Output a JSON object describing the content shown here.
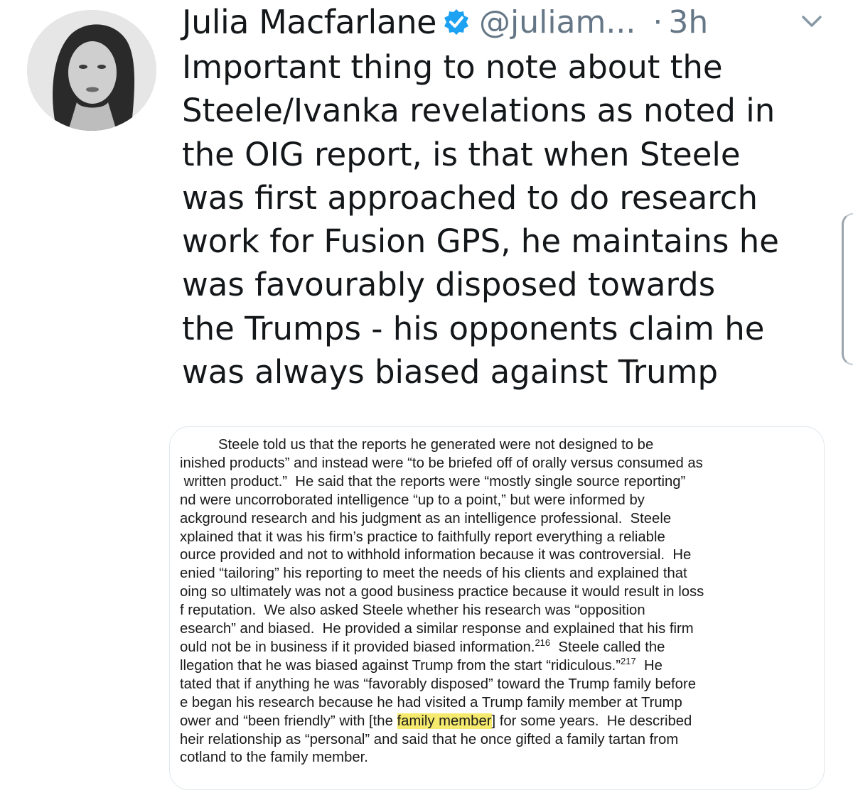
{
  "tweet": {
    "author": {
      "display_name": "Julia Macfarlane",
      "handle": "@juliam...",
      "verified": true,
      "avatar": "profile-photo-grayscale"
    },
    "separator": "·",
    "time": "3h",
    "menu_icon": "chevron-down-icon",
    "text_lines": [
      "Important thing to note about the",
      "Steele/Ivanka revelations as noted in",
      "the OIG report, is that when Steele",
      "was first approached to do research",
      "work for Fusion GPS, he maintains he",
      "was favourably disposed towards",
      "the Trumps - his opponents claim he",
      "was always biased against Trump"
    ]
  },
  "media": {
    "document_lines": [
      {
        "text": "Steele told us that the reports he generated were not designed to be"
      },
      {
        "text": "inished products” and instead were “to be briefed off of orally versus consumed as"
      },
      {
        "text": " written product.”  He said that the reports were “mostly single source reporting”"
      },
      {
        "text": "nd were uncorroborated intelligence “up to a point,” but were informed by"
      },
      {
        "text": "ackground research and his judgment as an intelligence professional.  Steele"
      },
      {
        "text": "xplained that it was his firm’s practice to faithfully report everything a reliable"
      },
      {
        "text": "ource provided and not to withhold information because it was controversial.  He"
      },
      {
        "text": "enied “tailoring” his reporting to meet the needs of his clients and explained that"
      },
      {
        "text": "oing so ultimately was not a good business practice because it would result in loss"
      },
      {
        "text": "f reputation.  We also asked Steele whether his research was “opposition"
      },
      {
        "text": "esearch” and biased.  He provided a similar response and explained that his firm"
      },
      {
        "pre": "ould not be in business if it provided biased information.",
        "sup": "216",
        "post": "  Steele called the"
      },
      {
        "pre": "llegation that he was biased against Trump from the start “ridiculous.”",
        "sup": "217",
        "post": "  He"
      },
      {
        "text": "tated that if anything he was “favorably disposed” toward the Trump family before"
      },
      {
        "text": "e began his research because he had visited a Trump family member at Trump"
      },
      {
        "pre": "ower and “been friendly” with [the ",
        "highlight": "family member",
        "post": "] for some years.  He described"
      },
      {
        "text": "heir relationship as “personal” and said that he once gifted a family tartan from"
      },
      {
        "text": "cotland to the family member."
      }
    ],
    "highlight_color": "#f6ea6e"
  },
  "colors": {
    "name": "#14171a",
    "secondary": "#657786",
    "verified_badge": "#1da1f2",
    "card_border": "#e1e8ed"
  }
}
